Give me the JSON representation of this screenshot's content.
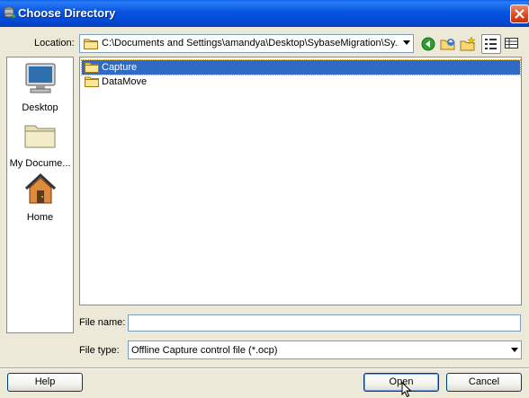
{
  "window": {
    "title": "Choose Directory"
  },
  "location": {
    "label": "Location:",
    "path": "C:\\Documents and Settings\\amandya\\Desktop\\SybaseMigration\\Sy..."
  },
  "toolbar": {
    "icons": [
      "back-icon",
      "up-folder-icon",
      "new-folder-icon",
      "list-view-icon",
      "details-view-icon"
    ]
  },
  "places": [
    {
      "label": "Desktop",
      "icon": "desktop-icon"
    },
    {
      "label": "My Docume...",
      "icon": "my-documents-icon"
    },
    {
      "label": "Home",
      "icon": "home-icon"
    }
  ],
  "files": [
    {
      "name": "Capture",
      "selected": true
    },
    {
      "name": "DataMove",
      "selected": false
    }
  ],
  "file_name": {
    "label": "File name:",
    "value": ""
  },
  "file_type": {
    "label": "File type:",
    "value": "Offline Capture control file (*.ocp)"
  },
  "buttons": {
    "help": "Help",
    "open": "Open",
    "cancel": "Cancel"
  },
  "colors": {
    "titlebar": "#0753e0",
    "selection": "#316ac5",
    "dialog_bg": "#ece9d8"
  }
}
